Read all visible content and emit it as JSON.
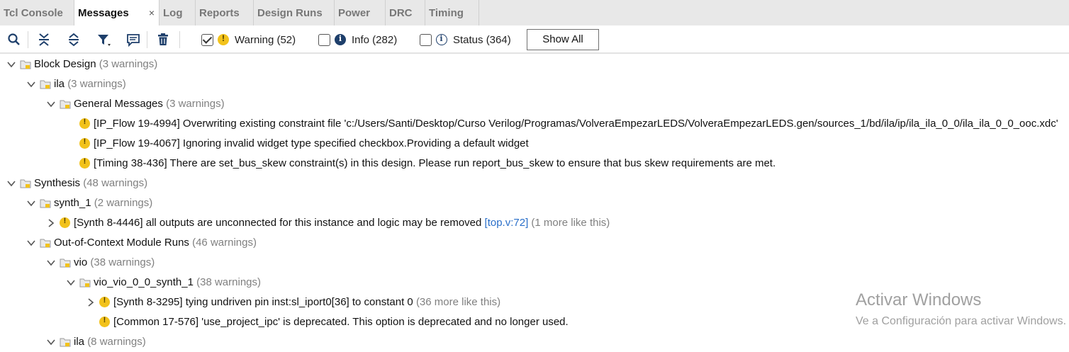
{
  "tabs": [
    {
      "label": "Tcl Console",
      "active": false
    },
    {
      "label": "Messages",
      "active": true,
      "close": "×"
    },
    {
      "label": "Log",
      "active": false
    },
    {
      "label": "Reports",
      "active": false
    },
    {
      "label": "Design Runs",
      "active": false
    },
    {
      "label": "Power",
      "active": false
    },
    {
      "label": "DRC",
      "active": false
    },
    {
      "label": "Timing",
      "active": false
    }
  ],
  "toolbar": {
    "icons": [
      "search-icon",
      "collapse-all-icon",
      "expand-all-icon",
      "filter-icon",
      "comment-icon",
      "delete-icon"
    ],
    "filters": {
      "warning": {
        "label": "Warning (52)",
        "checked": true
      },
      "info": {
        "label": "Info (282)",
        "checked": false
      },
      "status": {
        "label": "Status (364)",
        "checked": false
      }
    },
    "show_all": "Show All"
  },
  "tree": {
    "block_design": {
      "label": "Block Design",
      "count": "(3 warnings)"
    },
    "ila": {
      "label": "ila",
      "count": "(3 warnings)"
    },
    "general_messages": {
      "label": "General Messages",
      "count": "(3 warnings)"
    },
    "msg1": "[IP_Flow 19-4994] Overwriting existing constraint file 'c:/Users/Santi/Desktop/Curso Verilog/Programas/VolveraEmpezarLEDS/VolveraEmpezarLEDS.gen/sources_1/bd/ila/ip/ila_ila_0_0/ila_ila_0_0_ooc.xdc'",
    "msg2": "[IP_Flow 19-4067] Ignoring invalid widget type specified checkbox.Providing a default widget",
    "msg3": "[Timing 38-436] There are set_bus_skew constraint(s) in this design. Please run report_bus_skew to ensure that bus skew requirements are met.",
    "synthesis": {
      "label": "Synthesis",
      "count": "(48 warnings)"
    },
    "synth_1": {
      "label": "synth_1",
      "count": "(2 warnings)"
    },
    "msg4": {
      "text": "[Synth 8-4446] all outputs are unconnected for this instance and logic may be removed",
      "link": "[top.v:72]",
      "more": "(1 more like this)"
    },
    "ooc": {
      "label": "Out-of-Context Module Runs",
      "count": "(46 warnings)"
    },
    "vio": {
      "label": "vio",
      "count": "(38 warnings)"
    },
    "vio_synth": {
      "label": "vio_vio_0_0_synth_1",
      "count": "(38 warnings)"
    },
    "msg5": {
      "text": "[Synth 8-3295] tying undriven pin inst:sl_iport0[36] to constant 0",
      "more": "(36 more like this)"
    },
    "msg6": "[Common 17-576] 'use_project_ipc' is deprecated. This option is deprecated and no longer used.",
    "ila2": {
      "label": "ila",
      "count": "(8 warnings)"
    }
  },
  "watermark": {
    "title": "Activar Windows",
    "subtitle": "Ve a Configuración para activar Windows."
  },
  "colors": {
    "warning": "#f2c21b",
    "info": "#1e3f6b",
    "link": "#2a6fc9",
    "count": "#808080",
    "tab_bar": "#e8e8e8"
  }
}
